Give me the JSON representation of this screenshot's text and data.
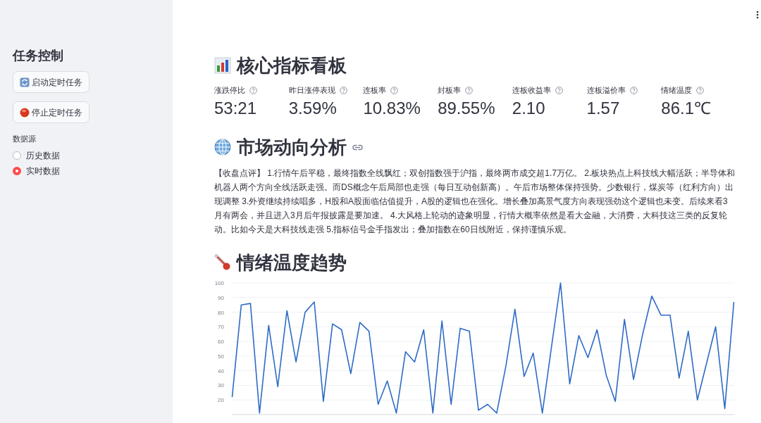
{
  "sidebar": {
    "title": "任务控制",
    "buttons": [
      {
        "kind": "refresh",
        "label": "启动定时任务"
      },
      {
        "kind": "stop",
        "label": "停止定时任务"
      }
    ],
    "data_source": {
      "label": "数据源",
      "options": [
        {
          "label": "历史数据",
          "selected": false
        },
        {
          "label": "实时数据",
          "selected": true
        }
      ]
    }
  },
  "dashboard": {
    "title": "核心指标看板",
    "metrics": [
      {
        "label": "涨跌停比",
        "value": "53:21"
      },
      {
        "label": "昨日涨停表现",
        "value": "3.59%"
      },
      {
        "label": "连板率",
        "value": "10.83%"
      },
      {
        "label": "封板率",
        "value": "89.55%"
      },
      {
        "label": "连板收益率",
        "value": "2.10"
      },
      {
        "label": "连板溢价率",
        "value": "1.57"
      },
      {
        "label": "情绪温度",
        "value": "86.1℃"
      }
    ]
  },
  "analysis": {
    "title": "市场动向分析",
    "text": "【收盘点评】 1.行情午后平稳，最终指数全线飘红；双创指数强于沪指，最终两市成交超1.7万亿。 2.板块热点上科技线大幅活跃；半导体和机器人两个方向全线活跃走强。而DS概念午后局部也走强（每日互动创新高）。午后市场整体保持强势。少数银行，煤炭等（红利方向）出现调整 3.外资继续持续唱多，H股和A股面临估值提升，A股的逻辑也在强化。增长叠加高景气度方向表现强劲这个逻辑也未变。后续来看3月有两会，并且进入3月后年报披露是要加速。 4.大风格上轮动的迹象明显，行情大概率依然是看大金融，大消费，大科技这三类的反复轮动。比如今天是大科技线走强 5.指标信号金手指发出；叠加指数在60日线附近，保持谨慎乐观。"
  },
  "trend": {
    "title": "情绪温度趋势",
    "chart_data": {
      "type": "line",
      "grid": true,
      "ylim": [
        10,
        100
      ],
      "yticks": [
        20,
        30,
        40,
        50,
        60,
        70,
        80,
        90,
        100
      ],
      "categories": [
        null,
        null,
        null,
        null,
        null,
        null,
        null,
        null,
        null,
        null,
        null,
        null,
        null,
        null,
        null,
        null,
        null,
        null,
        null,
        null,
        null,
        null,
        null,
        null,
        null,
        null,
        null,
        null,
        null,
        null,
        null,
        null,
        null,
        null,
        null,
        null,
        null,
        null,
        null,
        null,
        null,
        null,
        null,
        null,
        null,
        null,
        null,
        null,
        null,
        null,
        null,
        null,
        null,
        null,
        null,
        null
      ],
      "series": [
        {
          "color": "#2e6bc6",
          "values": [
            22,
            85,
            86,
            11,
            71,
            29,
            81,
            46,
            80,
            87,
            19,
            72,
            68,
            38,
            73,
            67,
            17,
            33,
            11,
            53,
            46,
            68,
            11,
            74,
            17,
            69,
            67,
            13,
            17,
            11,
            43,
            82,
            36,
            52,
            11,
            56,
            100,
            31,
            64,
            49,
            68,
            37,
            19,
            75,
            34,
            65,
            91,
            78,
            78,
            35,
            67,
            20,
            45,
            70,
            14,
            87
          ]
        }
      ]
    }
  }
}
